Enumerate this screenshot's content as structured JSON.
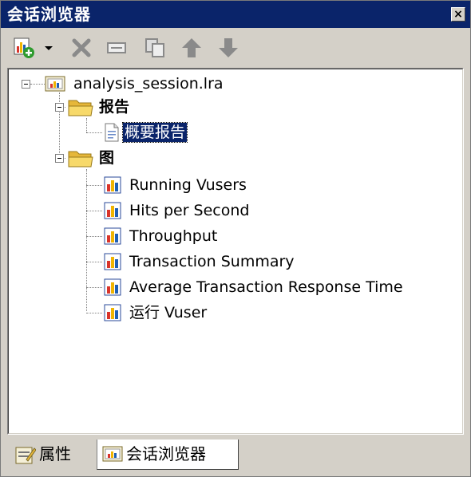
{
  "window": {
    "title": "会话浏览器",
    "close_glyph": "×"
  },
  "toolbar": {
    "buttons": [
      {
        "name": "add-graph",
        "icon": "add-graph-icon",
        "dropdown": true
      },
      {
        "name": "delete",
        "icon": "delete-x-icon"
      },
      {
        "name": "rename",
        "icon": "rename-icon"
      },
      {
        "name": "duplicate",
        "icon": "copy-icon"
      },
      {
        "name": "move-up",
        "icon": "arrow-up-icon"
      },
      {
        "name": "move-down",
        "icon": "arrow-down-icon"
      }
    ]
  },
  "tree": {
    "root": {
      "label": "analysis_session.lra",
      "icon": "session-icon",
      "expanded": true
    },
    "reports_folder": {
      "label": "报告",
      "icon": "folder-open-icon",
      "expanded": true
    },
    "report_items": [
      {
        "label": "概要报告",
        "icon": "document-icon",
        "selected": true
      }
    ],
    "graphs_folder": {
      "label": "图",
      "icon": "folder-open-icon",
      "expanded": true
    },
    "graph_items": [
      {
        "label": "Running Vusers",
        "icon": "bar-chart-icon"
      },
      {
        "label": "Hits per Second",
        "icon": "bar-chart-icon"
      },
      {
        "label": "Throughput",
        "icon": "bar-chart-icon"
      },
      {
        "label": "Transaction Summary",
        "icon": "bar-chart-icon"
      },
      {
        "label": "Average Transaction Response Time",
        "icon": "bar-chart-icon"
      },
      {
        "label": "运行 Vuser",
        "icon": "bar-chart-icon"
      }
    ]
  },
  "tabs": [
    {
      "label": "属性",
      "icon": "properties-icon",
      "active": false
    },
    {
      "label": "会话浏览器",
      "icon": "session-icon",
      "active": true
    }
  ],
  "colors": {
    "titlebar": "#0a246a",
    "selection": "#0a246a",
    "panel": "#d4d0c8",
    "bar_red": "#d9342b",
    "bar_yellow": "#f0b400",
    "bar_blue": "#1f5fb4",
    "folder": "#f2c94c"
  }
}
